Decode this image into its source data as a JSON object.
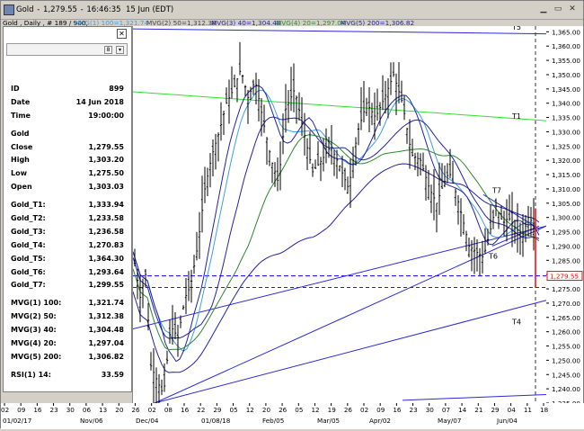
{
  "window": {
    "title_symbol": "Gold",
    "title_price": "1,279.55",
    "title_time": "16:46:35",
    "title_date": "15 Jun (EDT)"
  },
  "subtitle": {
    "base": "Gold , Daily , # 189 / 900,",
    "ma1": "MVG(1) 100=1,321.74",
    "ma2": "MVG(2) 50=1,312.38",
    "ma3": "MVG(3) 40=1,304.48",
    "ma4": "MVG(4) 20=1,297.04",
    "ma5": "MVG(5) 200=1,306.82"
  },
  "databox": {
    "page_indicator": "8",
    "rows": [
      {
        "k": "ID",
        "v": "899"
      },
      {
        "k": "Date",
        "v": "14 Jun 2018"
      },
      {
        "k": "Time",
        "v": "19:00:00"
      },
      {
        "k": "Gold",
        "v": ""
      },
      {
        "k": "Close",
        "v": "1,279.55"
      },
      {
        "k": "High",
        "v": "1,303.20"
      },
      {
        "k": "Low",
        "v": "1,275.50"
      },
      {
        "k": "Open",
        "v": "1,303.03"
      },
      {
        "k": "Gold_T1:",
        "v": "1,333.94"
      },
      {
        "k": "Gold_T2:",
        "v": "1,233.58"
      },
      {
        "k": "Gold_T3:",
        "v": "1,236.58"
      },
      {
        "k": "Gold_T4:",
        "v": "1,270.83"
      },
      {
        "k": "Gold_T5:",
        "v": "1,364.30"
      },
      {
        "k": "Gold_T6:",
        "v": "1,293.64"
      },
      {
        "k": "Gold_T7:",
        "v": "1,299.55"
      },
      {
        "k": "MVG(1) 100:",
        "v": "1,321.74"
      },
      {
        "k": "MVG(2) 50:",
        "v": "1,312.38"
      },
      {
        "k": "MVG(3) 40:",
        "v": "1,304.48"
      },
      {
        "k": "MVG(4) 20:",
        "v": "1,297.04"
      },
      {
        "k": "MVG(5) 200:",
        "v": "1,306.82"
      },
      {
        "k": "RSI(1) 14:",
        "v": "33.59"
      }
    ]
  },
  "chart_data": {
    "type": "candlestick",
    "y_ticks": [
      "1,365.00",
      "1,360.00",
      "1,355.00",
      "1,350.00",
      "1,345.00",
      "1,340.00",
      "1,335.00",
      "1,330.00",
      "1,325.00",
      "1,320.00",
      "1,315.00",
      "1,310.00",
      "1,305.00",
      "1,300.00",
      "1,295.00",
      "1,290.00",
      "1,285.00",
      "1,280.00",
      "1,275.00",
      "1,270.00",
      "1,265.00",
      "1,260.00",
      "1,255.00",
      "1,250.00",
      "1,245.00",
      "1,240.00",
      "1,235.00"
    ],
    "ylim": [
      1235,
      1367
    ],
    "current_price_label": "1,279.55",
    "trendline_labels": [
      "T5",
      "T1",
      "T7",
      "T6",
      "T4"
    ],
    "x_ticks_top": [
      "02",
      "09",
      "16",
      "23",
      "30",
      "06",
      "13",
      "20",
      "26",
      "02",
      "08",
      "16",
      "22",
      "29",
      "05",
      "12",
      "20",
      "26",
      "05",
      "12",
      "19",
      "26",
      "02",
      "09",
      "16",
      "23",
      "30",
      "07",
      "14",
      "21",
      "29",
      "04",
      "11",
      "18"
    ],
    "x_ticks_bottom": [
      "01/02/17",
      "Nov/06",
      "Dec/04",
      "01/08/18",
      "Feb/05",
      "Mar/05",
      "Apr/02",
      "May/07",
      "Jun/04"
    ],
    "colors": {
      "candle": "#000000",
      "ma_blue": "#2222aa",
      "ma_lightblue": "#3aa0e6",
      "ma_green": "#2a8a2a",
      "trend_blue": "#2a2ad8",
      "trend_green": "#2ee02e",
      "price_line": "#ff0000",
      "hline_blue": "#0000ff"
    }
  }
}
